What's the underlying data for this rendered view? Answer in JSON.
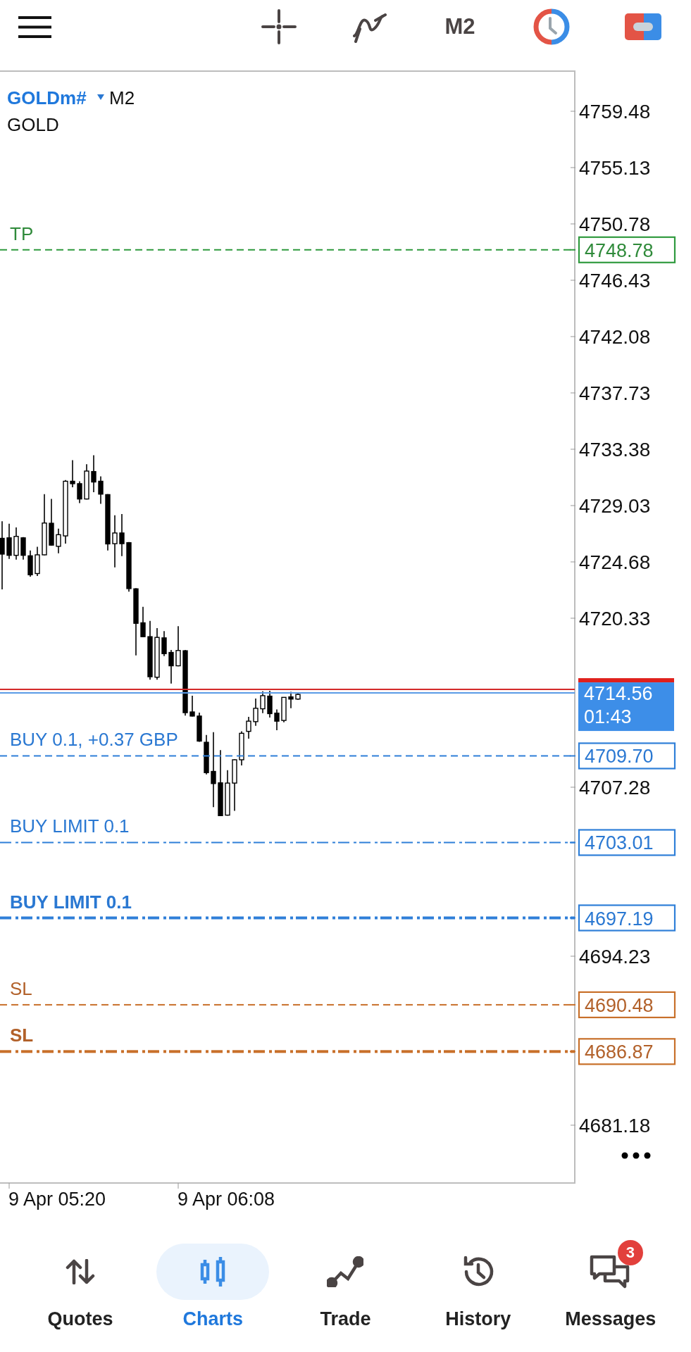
{
  "toolbar": {
    "timeframe": "M2"
  },
  "chart": {
    "symbol": "GOLDm#",
    "timeframe": "M2",
    "description": "GOLD",
    "price_axis": [
      "4759.48",
      "4755.13",
      "4750.78",
      "4746.43",
      "4742.08",
      "4737.73",
      "4733.38",
      "4729.03",
      "4724.68",
      "4720.33",
      "4707.28",
      "4694.23",
      "4681.18"
    ],
    "levels": [
      {
        "kind": "tp",
        "label": "TP",
        "price": "4748.78",
        "pending": false,
        "highlighted": false
      },
      {
        "kind": "buy",
        "label": "BUY 0.1,  +0.37 GBP",
        "price": "4709.70",
        "pending": false,
        "highlighted": false
      },
      {
        "kind": "buy",
        "label": "BUY LIMIT 0.1",
        "price": "4703.01",
        "pending": true,
        "highlighted": false
      },
      {
        "kind": "buy",
        "label": "BUY LIMIT 0.1",
        "price": "4697.19",
        "pending": true,
        "highlighted": true
      },
      {
        "kind": "sl",
        "label": "SL",
        "price": "4690.48",
        "pending": false,
        "highlighted": false
      },
      {
        "kind": "sl",
        "label": "SL",
        "price": "4686.87",
        "pending": true,
        "highlighted": true
      }
    ],
    "current": {
      "price": "4714.56",
      "countdown": "01:43"
    },
    "time_axis": [
      "9 Apr 05:20",
      "9 Apr 06:08"
    ]
  },
  "nav": [
    {
      "label": "Quotes",
      "selected": false
    },
    {
      "label": "Charts",
      "selected": true
    },
    {
      "label": "Trade",
      "selected": false
    },
    {
      "label": "History",
      "selected": false
    },
    {
      "label": "Messages",
      "selected": false,
      "badge": "3"
    }
  ]
}
